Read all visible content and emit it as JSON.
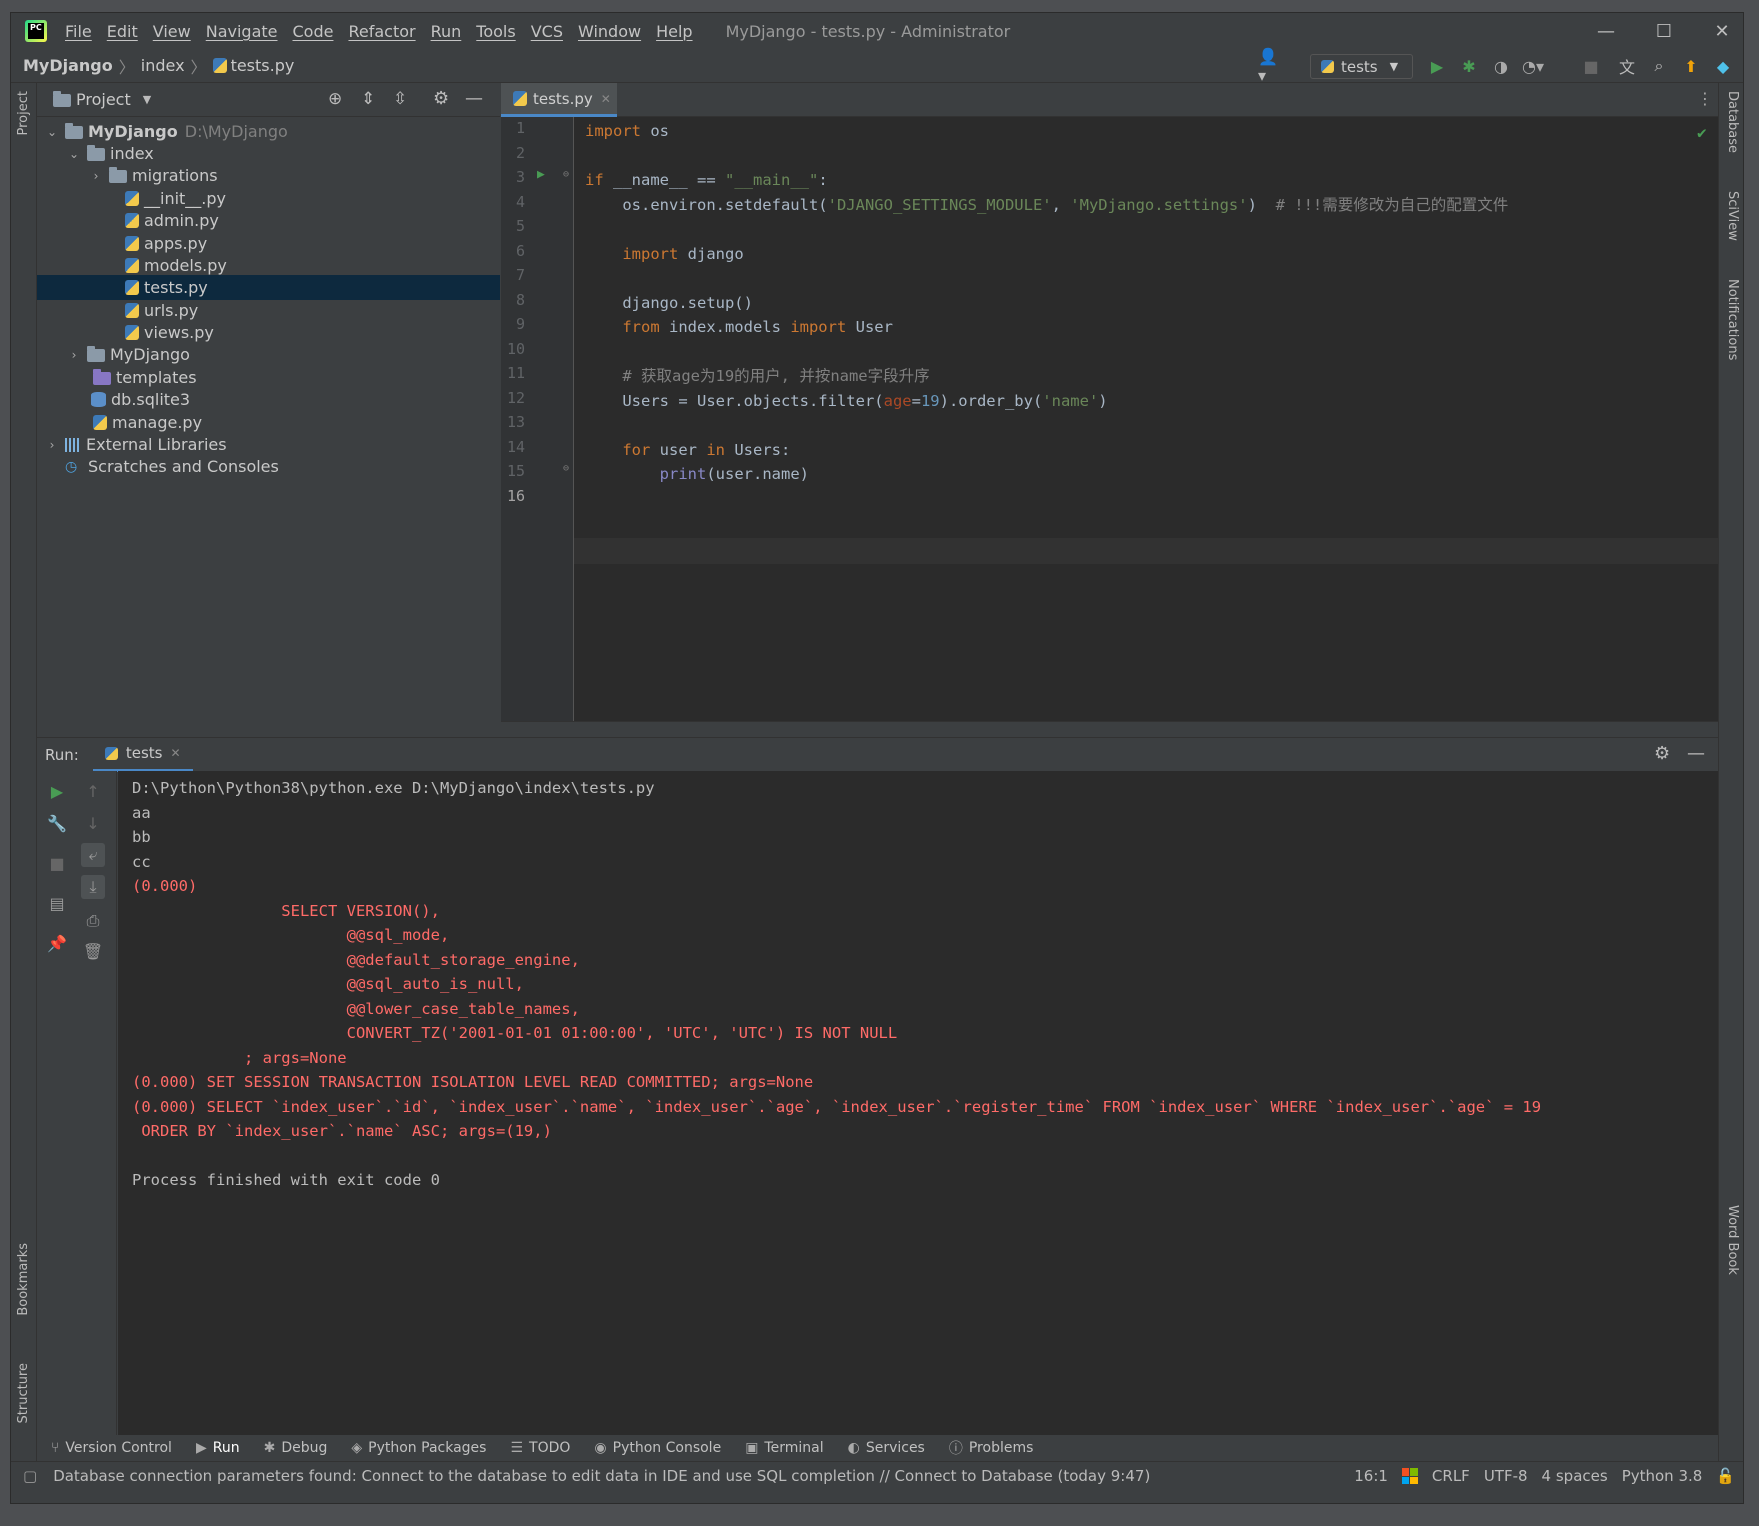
{
  "window": {
    "title": "MyDjango - tests.py - Administrator",
    "menu": [
      "File",
      "Edit",
      "View",
      "Navigate",
      "Code",
      "Refactor",
      "Run",
      "Tools",
      "VCS",
      "Window",
      "Help"
    ]
  },
  "breadcrumb": {
    "project": "MyDjango",
    "folder": "index",
    "file": "tests.py"
  },
  "toolbar": {
    "run_config": "tests"
  },
  "project_panel": {
    "title": "Project",
    "tree": [
      {
        "label": "MyDjango",
        "hint": "D:\\MyDjango",
        "icon": "folder-icon"
      },
      {
        "label": "index",
        "icon": "folder-icon"
      },
      {
        "label": "migrations",
        "icon": "folder-icon"
      },
      {
        "label": "__init__.py",
        "icon": "python-file-icon"
      },
      {
        "label": "admin.py",
        "icon": "python-file-icon"
      },
      {
        "label": "apps.py",
        "icon": "python-file-icon"
      },
      {
        "label": "models.py",
        "icon": "python-file-icon"
      },
      {
        "label": "tests.py",
        "icon": "python-file-icon",
        "selected": true
      },
      {
        "label": "urls.py",
        "icon": "python-file-icon"
      },
      {
        "label": "views.py",
        "icon": "python-file-icon"
      },
      {
        "label": "MyDjango",
        "icon": "folder-icon"
      },
      {
        "label": "templates",
        "icon": "template-folder-icon"
      },
      {
        "label": "db.sqlite3",
        "icon": "database-file-icon"
      },
      {
        "label": "manage.py",
        "icon": "python-file-icon"
      },
      {
        "label": "External Libraries",
        "icon": "library-icon"
      },
      {
        "label": "Scratches and Consoles",
        "icon": "scratches-icon"
      }
    ]
  },
  "editor": {
    "tab": "tests.py",
    "line_numbers": [
      "1",
      "2",
      "3",
      "4",
      "5",
      "6",
      "7",
      "8",
      "9",
      "10",
      "11",
      "12",
      "13",
      "14",
      "15",
      "16"
    ],
    "code": {
      "l1_kw": "import",
      "l1_rest": " os",
      "l3_kw": "if",
      "l3_mid": " __name__ == ",
      "l3_str": "\"__main__\"",
      "l3_end": ":",
      "l4_a": "    os.environ.setdefault(",
      "l4_s1": "'DJANGO_SETTINGS_MODULE'",
      "l4_b": ", ",
      "l4_s2": "'MyDjango.settings'",
      "l4_c": ")  ",
      "l4_cmt": "# !!!需要修改为自己的配置文件",
      "l6_kw": "    import",
      "l6_rest": " django",
      "l8": "    django.setup()",
      "l9_kw1": "    from",
      "l9_mid": " index.models ",
      "l9_kw2": "import",
      "l9_rest": " User",
      "l11_cmt": "    # 获取age为19的用户, 并按name字段升序",
      "l12_a": "    Users = User.objects.filter(",
      "l12_p": "age",
      "l12_b": "=",
      "l12_n": "19",
      "l12_c": ").order_by(",
      "l12_s": "'name'",
      "l12_d": ")",
      "l14_kw1": "    for",
      "l14_mid": " user ",
      "l14_kw2": "in",
      "l14_rest": " Users:",
      "l15_bi": "        print",
      "l15_rest": "(user.name)"
    }
  },
  "run_panel": {
    "label": "Run:",
    "tab": "tests",
    "output": [
      {
        "text": "D:\\Python\\Python38\\python.exe D:\\MyDjango\\index\\tests.py",
        "err": false
      },
      {
        "text": "aa",
        "err": false
      },
      {
        "text": "bb",
        "err": false
      },
      {
        "text": "cc",
        "err": false
      },
      {
        "text": "(0.000)",
        "err": true
      },
      {
        "text": "                SELECT VERSION(),",
        "err": true
      },
      {
        "text": "                       @@sql_mode,",
        "err": true
      },
      {
        "text": "                       @@default_storage_engine,",
        "err": true
      },
      {
        "text": "                       @@sql_auto_is_null,",
        "err": true
      },
      {
        "text": "                       @@lower_case_table_names,",
        "err": true
      },
      {
        "text": "                       CONVERT_TZ('2001-01-01 01:00:00', 'UTC', 'UTC') IS NOT NULL",
        "err": true
      },
      {
        "text": "            ; args=None",
        "err": true
      },
      {
        "text": "(0.000) SET SESSION TRANSACTION ISOLATION LEVEL READ COMMITTED; args=None",
        "err": true
      },
      {
        "text": "(0.000) SELECT `index_user`.`id`, `index_user`.`name`, `index_user`.`age`, `index_user`.`register_time` FROM `index_user` WHERE `index_user`.`age` = 19",
        "err": true
      },
      {
        "text": " ORDER BY `index_user`.`name` ASC; args=(19,)",
        "err": true
      },
      {
        "text": "",
        "err": false
      },
      {
        "text": "Process finished with exit code 0",
        "err": false
      }
    ]
  },
  "side_strips": {
    "left_top": "Project",
    "left_bottom1": "Bookmarks",
    "left_bottom2": "Structure",
    "right1": "Database",
    "right2": "SciView",
    "right3": "Notifications",
    "right4": "Word Book"
  },
  "tool_tabs": [
    "Version Control",
    "Run",
    "Debug",
    "Python Packages",
    "TODO",
    "Python Console",
    "Terminal",
    "Services",
    "Problems"
  ],
  "status_bar": {
    "message": "Database connection parameters found: Connect to the database to edit data in IDE and use SQL completion // Connect to Database (today 9:47)",
    "position": "16:1",
    "line_sep": "CRLF",
    "encoding": "UTF-8",
    "indent": "4 spaces",
    "interpreter": "Python 3.8"
  },
  "colors": {
    "accent": "#4a88c7",
    "keyword": "#cc7832",
    "string": "#6a8759",
    "comment": "#808080",
    "error_output": "#ff6b68",
    "run_green": "#499c54"
  }
}
